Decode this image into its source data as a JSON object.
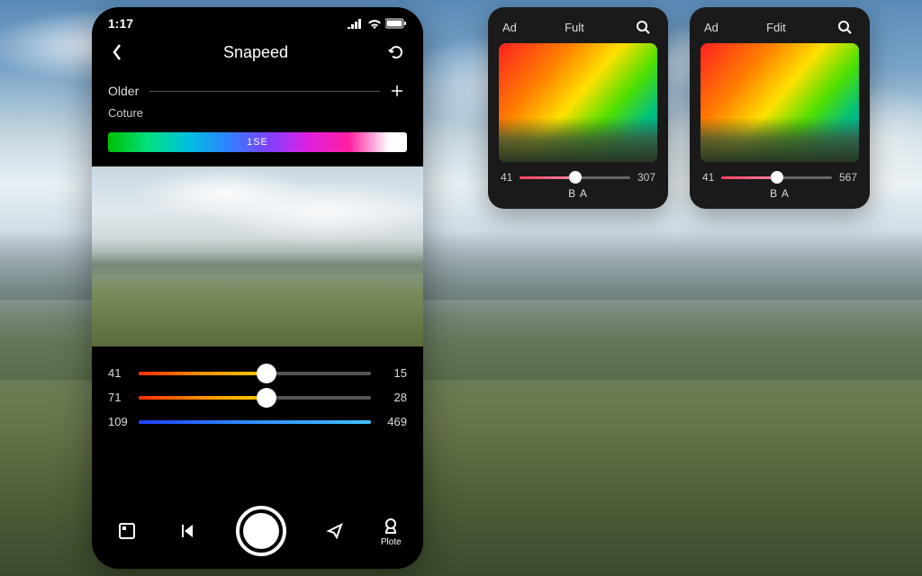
{
  "status": {
    "time": "1:17"
  },
  "header": {
    "title": "Snapeed"
  },
  "section": {
    "older_label": "Older",
    "sub_label": "Coture",
    "hue_label": "1SE"
  },
  "sliders": [
    {
      "left": "41",
      "right": "15",
      "fill": 55
    },
    {
      "left": "71",
      "right": "28",
      "fill": 55
    },
    {
      "left": "109",
      "right": "469",
      "fill": 100,
      "blue": true,
      "nothumb": true
    }
  ],
  "bottom": {
    "plote_label": "Plote"
  },
  "panel_a": {
    "tab1": "Ad",
    "tab2": "Fult",
    "val_left": "41",
    "val_right": "307",
    "footer": "B A"
  },
  "panel_b": {
    "tab1": "Ad",
    "tab2": "Fdit",
    "val_left": "41",
    "val_right": "567",
    "footer": "B A"
  }
}
